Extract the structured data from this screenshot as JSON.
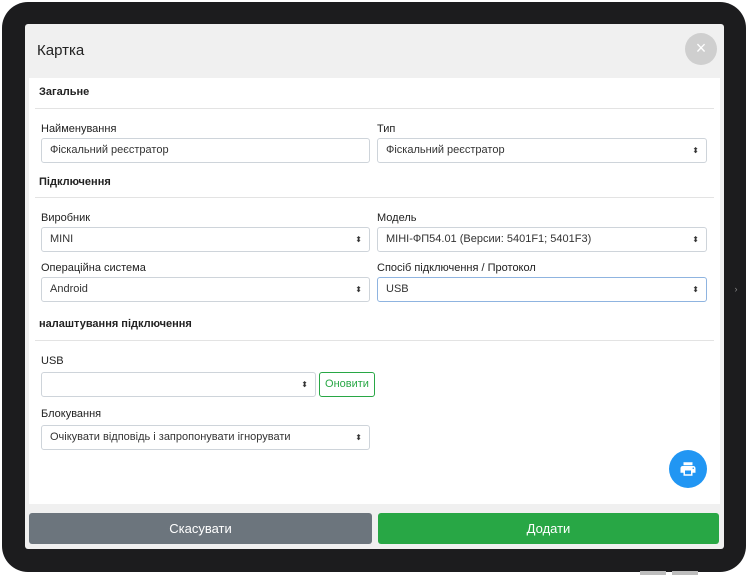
{
  "modal": {
    "title": "Картка",
    "close_icon": "×"
  },
  "sections": {
    "general": "Загальне",
    "connection": "Підключення",
    "connection_settings": "налаштування підключення"
  },
  "fields": {
    "name": {
      "label": "Найменування",
      "value": "Фіскальний реєстратор"
    },
    "type": {
      "label": "Тип",
      "value": "Фіскальний реєстратор"
    },
    "manufacturer": {
      "label": "Виробник",
      "value": "MINI"
    },
    "model": {
      "label": "Модель",
      "value": "МІНІ-ФП54.01 (Версии: 5401F1; 5401F3)"
    },
    "os": {
      "label": "Операційна система",
      "value": "Android"
    },
    "protocol": {
      "label": "Спосіб підключення / Протокол",
      "value": "USB"
    },
    "usb": {
      "label": "USB",
      "value": "",
      "refresh_label": "Оновити"
    },
    "blocking": {
      "label": "Блокування",
      "value": "Очікувати відповідь і запропонувати ігнорувати"
    }
  },
  "footer": {
    "cancel_label": "Скасувати",
    "add_label": "Додати"
  },
  "icons": {
    "select_caret": "select-caret-icon",
    "print": "printer-icon",
    "close": "close-icon"
  },
  "colors": {
    "primary_green": "#28a745",
    "secondary_gray": "#6c757d",
    "fab_blue": "#2196f3"
  }
}
